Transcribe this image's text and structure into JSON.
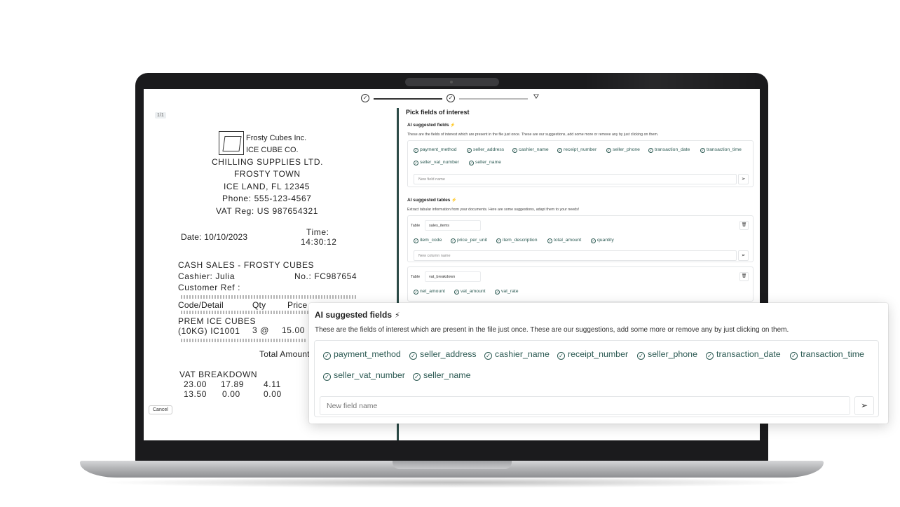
{
  "stepper": {
    "step1_icon": "✓",
    "step2_icon": "✓",
    "step3_icon": "⛛"
  },
  "receipt": {
    "page_badge": "1/1",
    "header": {
      "company1": "Frosty Cubes Inc.",
      "company2": "ICE CUBE CO.",
      "company3": "CHILLING SUPPLIES LTD.",
      "town": "FROSTY TOWN",
      "address": "ICE LAND, FL 12345",
      "phone": "Phone: 555-123-4567",
      "vat": "VAT Reg: US 987654321"
    },
    "date": "Date: 10/10/2023",
    "time_label": "Time:",
    "time_value": "14:30:12",
    "sale_title": "CASH SALES - FROSTY CUBES",
    "cashier": "Cashier: Julia",
    "number": "No.: FC987654",
    "customer_ref": "Customer Ref :",
    "col_code": "Code/Detail",
    "col_qty": "Qty",
    "col_price": "Price",
    "item_name": "PREM ICE CUBES",
    "item_code": "(10KG) IC1001",
    "item_qty": "3 @",
    "item_price": "15.00",
    "total_amount": "Total Amount",
    "vat_breakdown": "VAT BREAKDOWN",
    "vat_row1": [
      "23.00",
      "17.89",
      "4.11"
    ],
    "vat_row2": [
      "13.50",
      "0.00",
      "0.00"
    ],
    "cancel": "Cancel"
  },
  "panel": {
    "title": "Pick fields of interest",
    "fields_heading": "AI suggested fields",
    "fields_desc": "These are the fields of interest which are present in the file just once. These are our suggestions, add some more or remove any by just clicking on them.",
    "fields": [
      "payment_method",
      "seller_address",
      "cashier_name",
      "receipt_number",
      "seller_phone",
      "transaction_date",
      "transaction_time",
      "seller_vat_number",
      "seller_name"
    ],
    "new_field_placeholder": "New field name",
    "tables_heading": "AI suggested tables",
    "tables_desc": "Extract tabular information from your documents. Here are some suggestions, adapt them to your needs!",
    "table_label": "Table",
    "tables": [
      {
        "name": "sales_items",
        "columns": [
          "item_code",
          "price_per_unit",
          "item_description",
          "total_amount",
          "quantity"
        ]
      },
      {
        "name": "vat_breakdown",
        "columns": [
          "net_amount",
          "vat_amount",
          "vat_rate"
        ]
      }
    ],
    "new_column_placeholder": "New column name"
  },
  "popup": {
    "title": "AI suggested fields",
    "desc": "These are the fields of interest which are present in the file just once. These are our suggestions, add some more or remove any by just clicking on them.",
    "fields": [
      "payment_method",
      "seller_address",
      "cashier_name",
      "receipt_number",
      "seller_phone",
      "transaction_date",
      "transaction_time",
      "seller_vat_number",
      "seller_name"
    ],
    "placeholder": "New field name"
  },
  "icons": {
    "check": "✓",
    "send": "➢",
    "trash": "🗑",
    "wand": "⚡"
  },
  "colors": {
    "accent": "#2c5a53",
    "panel_border": "#2c4b47"
  }
}
